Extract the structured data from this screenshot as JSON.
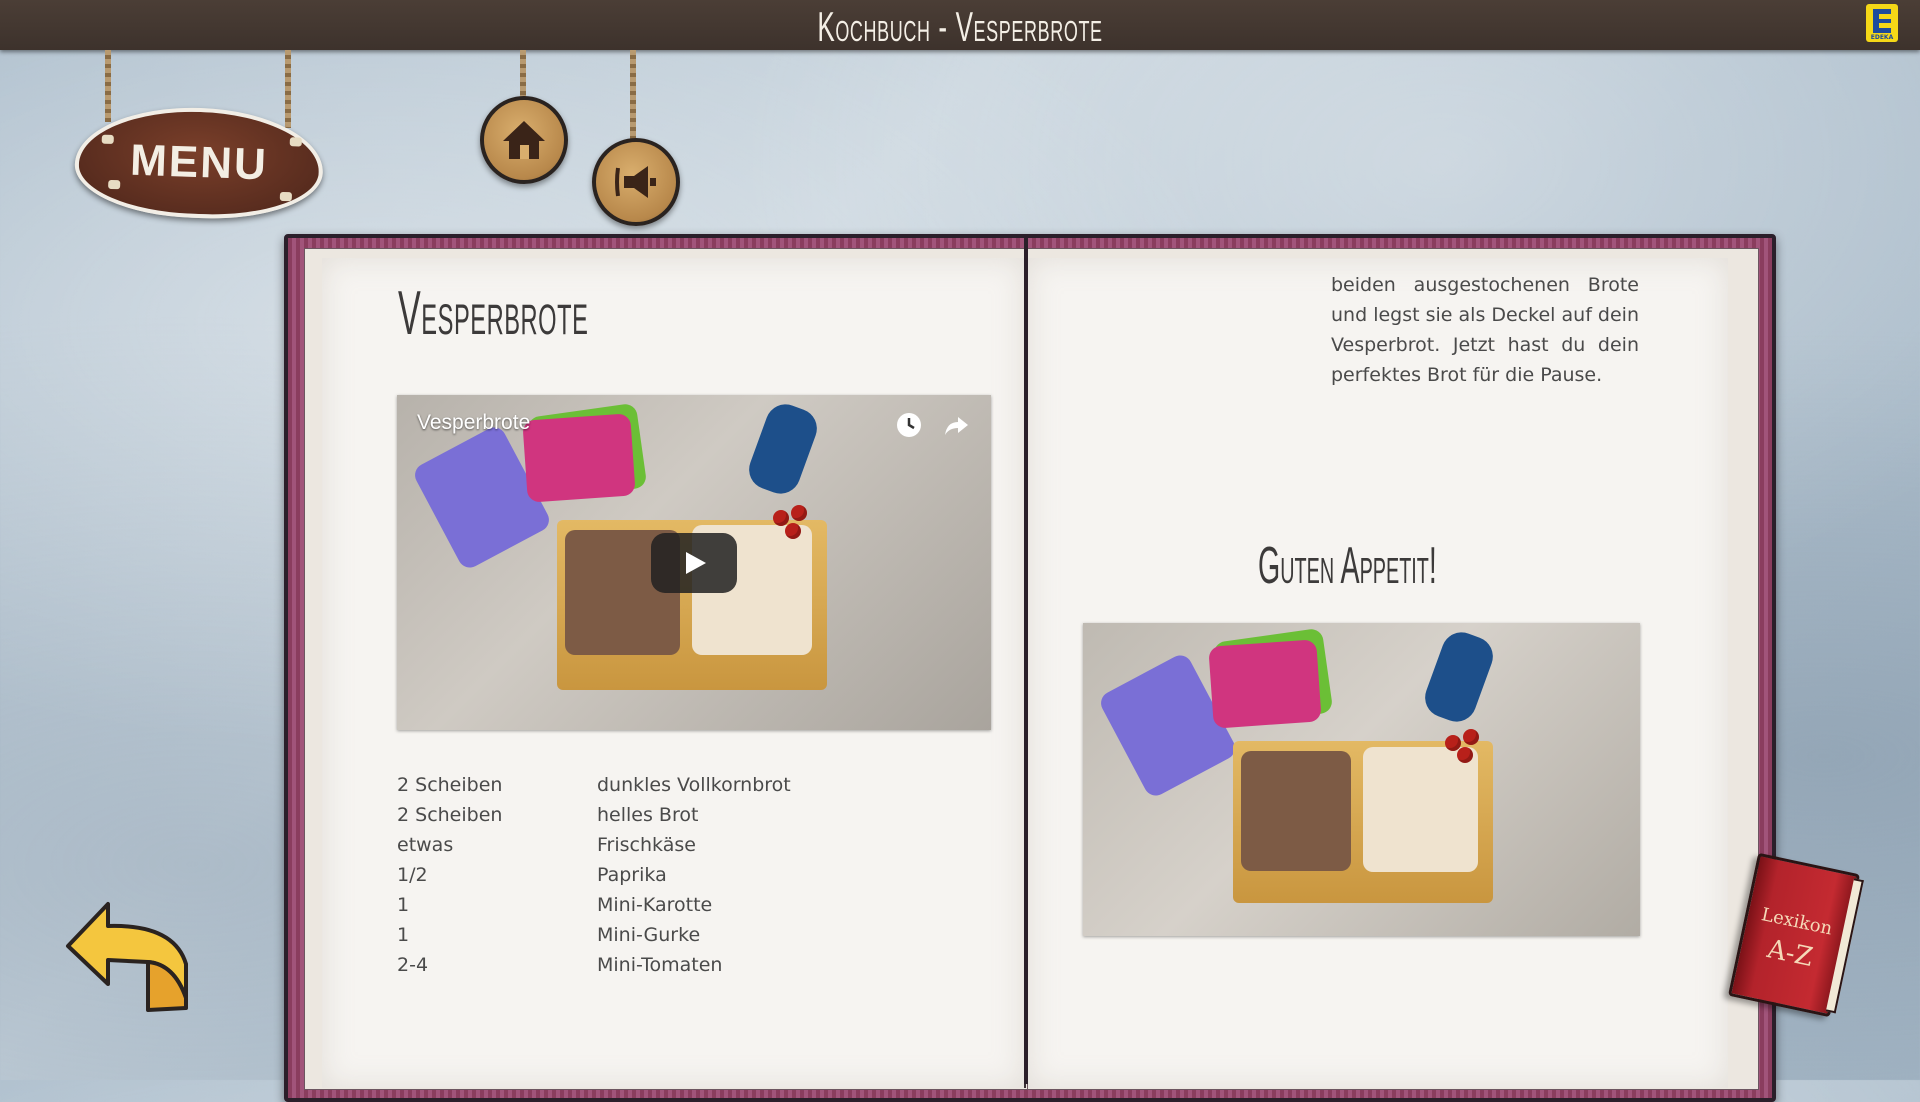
{
  "header": {
    "title": "Kochbuch - Vesperbrote",
    "logo_text": "EDEKA"
  },
  "nav": {
    "menu_label": "MENU"
  },
  "left_page": {
    "title": "Vesperbrote",
    "video": {
      "title": "Vesperbrote"
    },
    "ingredients": [
      {
        "qty": "2 Scheiben",
        "name": "dunkles Vollkornbrot"
      },
      {
        "qty": "2 Scheiben",
        "name": "helles Brot"
      },
      {
        "qty": "etwas",
        "name": "Frischkäse"
      },
      {
        "qty": "1/2",
        "name": "Paprika"
      },
      {
        "qty": "1",
        "name": "Mini-Karotte"
      },
      {
        "qty": "1",
        "name": "Mini-Gurke"
      },
      {
        "qty": "2-4",
        "name": "Mini-Tomaten"
      }
    ]
  },
  "right_page": {
    "text": "beiden ausgestochenen Brote und legst sie als Deckel auf dein Vesperbrot. Jetzt hast du dein perfektes Brot für die Pause.",
    "closing": "Guten Appetit!"
  },
  "lexikon": {
    "line1": "Lexikon",
    "line2": "A-Z"
  },
  "colors": {
    "header_bg": "#3d322c",
    "book_cover": "#8d4464",
    "page": "#f6f4f1",
    "menu_sign": "#5a2d1f",
    "arrow": "#f2c53d"
  },
  "icons": [
    "home-icon",
    "sound-icon",
    "play-icon",
    "watch-later-icon",
    "share-icon",
    "back-arrow-icon"
  ]
}
